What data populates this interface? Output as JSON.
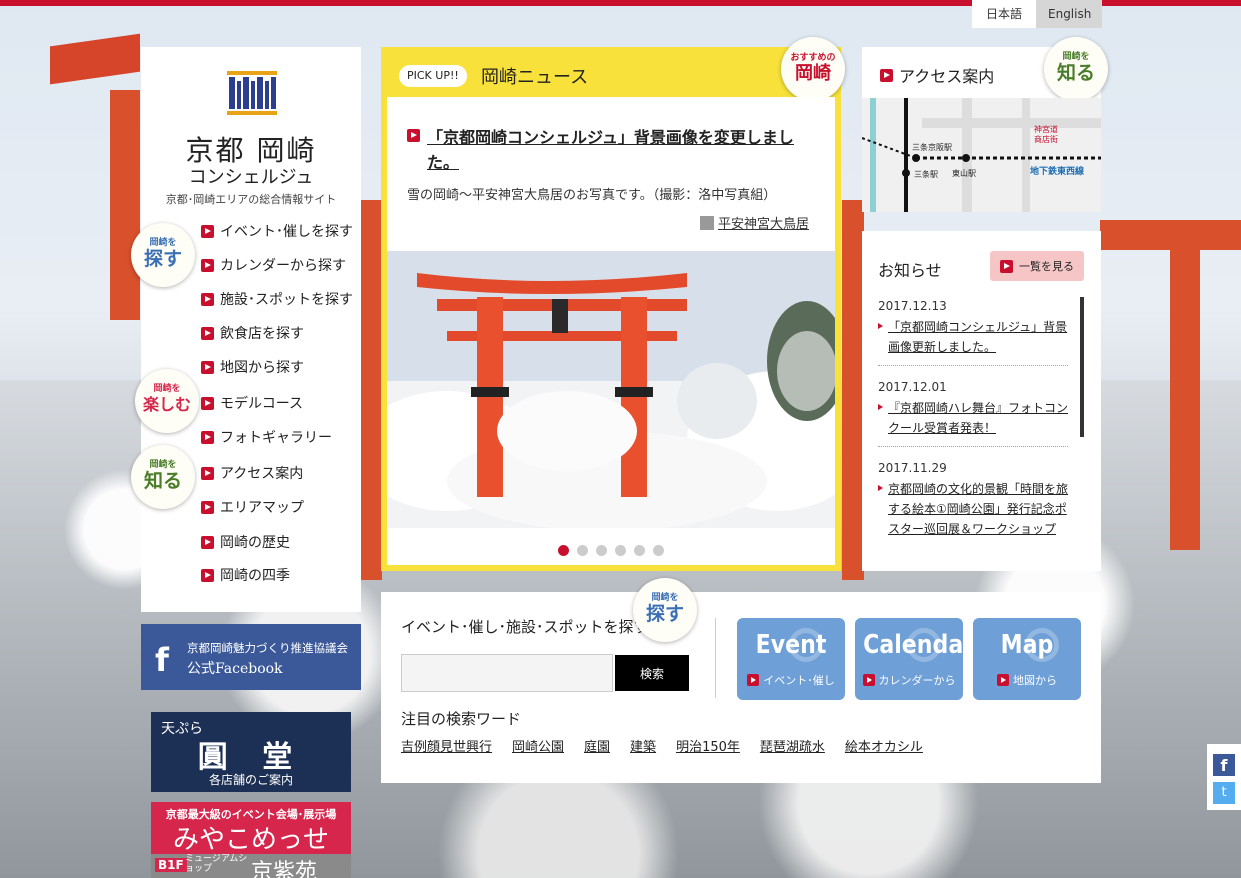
{
  "lang": {
    "ja": "日本語",
    "en": "English"
  },
  "sidebar": {
    "title": "京都 岡崎",
    "title2": "コンシェルジュ",
    "subtitle": "京都･岡崎エリアの総合情報サイト",
    "badges": {
      "sagasu_small": "岡崎を",
      "sagasu": "探す",
      "tanoshimu_small": "岡崎を",
      "tanoshimu": "楽しむ",
      "shiru_small": "岡崎を",
      "shiru": "知る"
    },
    "items": [
      {
        "label": "イベント･催しを探す"
      },
      {
        "label": "カレンダーから探す"
      },
      {
        "label": "施設･スポットを探す"
      },
      {
        "label": "飲食店を探す"
      },
      {
        "label": "地図から探す"
      },
      {
        "label": "モデルコース"
      },
      {
        "label": "フォトギャラリー"
      },
      {
        "label": "アクセス案内"
      },
      {
        "label": "エリアマップ"
      },
      {
        "label": "岡崎の歴史"
      },
      {
        "label": "岡崎の四季"
      }
    ]
  },
  "facebook": {
    "line1": "京都岡崎魅力づくり推進協議会",
    "line2": "公式Facebook"
  },
  "banner_shop": {
    "top": "天ぷら",
    "name": "圓 堂",
    "bottom": "各店舗のご案内"
  },
  "banner_miyako": {
    "top": "京都最大級のイベント会場･展示場",
    "name": "みやこめっせ",
    "floor": "B1F",
    "museum": "ミュージアムショップ",
    "shop": "京紫苑"
  },
  "pickup": {
    "tag": "PICK UP!!",
    "title": "岡崎ニュース",
    "rec_small": "おすすめの",
    "rec_big": "岡崎",
    "headline": "「京都岡崎コンシェルジュ」背景画像を変更しました。",
    "description": "雪の岡崎～平安神宮大鳥居のお写真です。（撮影：洛中写真組）",
    "caption": "平安神宮大鳥居",
    "slides": [
      1,
      2,
      3,
      4,
      5,
      6
    ],
    "active_slide": 0
  },
  "access": {
    "title": "アクセス案内",
    "badge_small": "岡崎を",
    "badge_big": "知る",
    "map": {
      "station1": "三条京阪駅",
      "station2": "三条駅",
      "station3": "東山駅",
      "area": "神宮道",
      "area2": "商店街",
      "line": "地下鉄東西線"
    }
  },
  "notice": {
    "title": "お知らせ",
    "list_button": "一覧を見る",
    "items": [
      {
        "date": "2017.12.13",
        "text": "「京都岡崎コンシェルジュ」背景画像更新しました。"
      },
      {
        "date": "2017.12.01",
        "text": "『京都岡崎ハレ舞台』フォトコンクール受賞者発表！"
      },
      {
        "date": "2017.11.29",
        "text": "京都岡崎の文化的景観「時間を旅する絵本①岡崎公園」発行記念ポスター巡回展＆ワークショップ"
      }
    ]
  },
  "search": {
    "title": "イベント･催し･施設･スポットを探す",
    "badge_small": "岡崎を",
    "badge_big": "探す",
    "input_value": "",
    "button": "検索",
    "tiles": [
      {
        "big": "Event",
        "small": "イベント･催し"
      },
      {
        "big": "Calendar",
        "small": "カレンダーから"
      },
      {
        "big": "Map",
        "small": "地図から"
      }
    ],
    "keyword_title": "注目の検索ワード",
    "keywords": [
      "吉例顔見世興行",
      "岡崎公園",
      "庭園",
      "建築",
      "明治150年",
      "琵琶湖疏水",
      "絵本オカシル"
    ]
  },
  "social": {
    "fb": "f",
    "tw": "t"
  },
  "colors": {
    "accent": "#c8102e",
    "pickup_bg": "#f7e13a",
    "tile": "#6e9fd7",
    "facebook": "#3b5998"
  }
}
